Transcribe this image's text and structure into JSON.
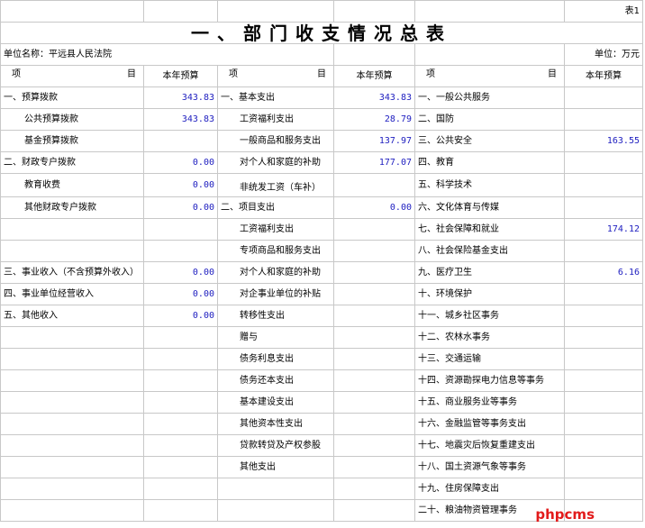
{
  "sheet_label": "表1",
  "title": "一、部门收支情况总表",
  "unit_name": "单位名称：平远县人民法院",
  "unit_label": "单位：万元",
  "headers": {
    "item_left": "项",
    "item_right": "目",
    "budget": "本年预算"
  },
  "rows": [
    {
      "c1": "一、预算拨款",
      "c2": "343.83",
      "c3": "一、基本支出",
      "c4": "343.83",
      "c5": "一、一般公共服务",
      "c6": ""
    },
    {
      "c1": "公共预算拨款",
      "c2": "343.83",
      "c3": "工资福利支出",
      "c4": "28.79",
      "c5": "二、国防",
      "c6": ""
    },
    {
      "c1": "基金预算拨款",
      "c2": "",
      "c3": "一般商品和服务支出",
      "c4": "137.97",
      "c5": "三、公共安全",
      "c6": "163.55"
    },
    {
      "c1": "二、财政专户拨款",
      "c2": "0.00",
      "c3": "对个人和家庭的补助",
      "c4": "177.07",
      "c5": "四、教育",
      "c6": ""
    },
    {
      "c1": "教育收费",
      "c2": "0.00",
      "c3": "非统发工资（车补）",
      "c4": "",
      "c5": "五、科学技术",
      "c6": ""
    },
    {
      "c1": "其他财政专户拨款",
      "c2": "0.00",
      "c3": "二、项目支出",
      "c4": "0.00",
      "c5": "六、文化体育与传媒",
      "c6": ""
    },
    {
      "c1": "",
      "c2": "",
      "c3": "工资福利支出",
      "c4": "",
      "c5": "七、社会保障和就业",
      "c6": "174.12"
    },
    {
      "c1": "",
      "c2": "",
      "c3": "专项商品和服务支出",
      "c4": "",
      "c5": "八、社会保险基金支出",
      "c6": ""
    },
    {
      "c1": "三、事业收入（不含预算外收入）",
      "c2": "0.00",
      "c3": "对个人和家庭的补助",
      "c4": "",
      "c5": "九、医疗卫生",
      "c6": "6.16"
    },
    {
      "c1": "四、事业单位经营收入",
      "c2": "0.00",
      "c3": "对企事业单位的补贴",
      "c4": "",
      "c5": "十、环境保护",
      "c6": ""
    },
    {
      "c1": "五、其他收入",
      "c2": "0.00",
      "c3": "转移性支出",
      "c4": "",
      "c5": "十一、城乡社区事务",
      "c6": ""
    },
    {
      "c1": "",
      "c2": "",
      "c3": "赠与",
      "c4": "",
      "c5": "十二、农林水事务",
      "c6": ""
    },
    {
      "c1": "",
      "c2": "",
      "c3": "债务利息支出",
      "c4": "",
      "c5": "十三、交通运输",
      "c6": ""
    },
    {
      "c1": "",
      "c2": "",
      "c3": "债务还本支出",
      "c4": "",
      "c5": "十四、资源勘探电力信息等事务",
      "c6": ""
    },
    {
      "c1": "",
      "c2": "",
      "c3": "基本建设支出",
      "c4": "",
      "c5": "十五、商业服务业等事务",
      "c6": ""
    },
    {
      "c1": "",
      "c2": "",
      "c3": "其他资本性支出",
      "c4": "",
      "c5": "十六、金融监管等事务支出",
      "c6": ""
    },
    {
      "c1": "",
      "c2": "",
      "c3": "贷款转贷及产权参股",
      "c4": "",
      "c5": "十七、地震灾后恢复重建支出",
      "c6": ""
    },
    {
      "c1": "",
      "c2": "",
      "c3": "其他支出",
      "c4": "",
      "c5": "十八、国土资源气象等事务",
      "c6": ""
    },
    {
      "c1": "",
      "c2": "",
      "c3": "",
      "c4": "",
      "c5": "十九、住房保障支出",
      "c6": ""
    },
    {
      "c1": "",
      "c2": "",
      "c3": "",
      "c4": "",
      "c5": "二十、粮油物资管理事务",
      "c6": ""
    }
  ],
  "watermark": "phpcms"
}
